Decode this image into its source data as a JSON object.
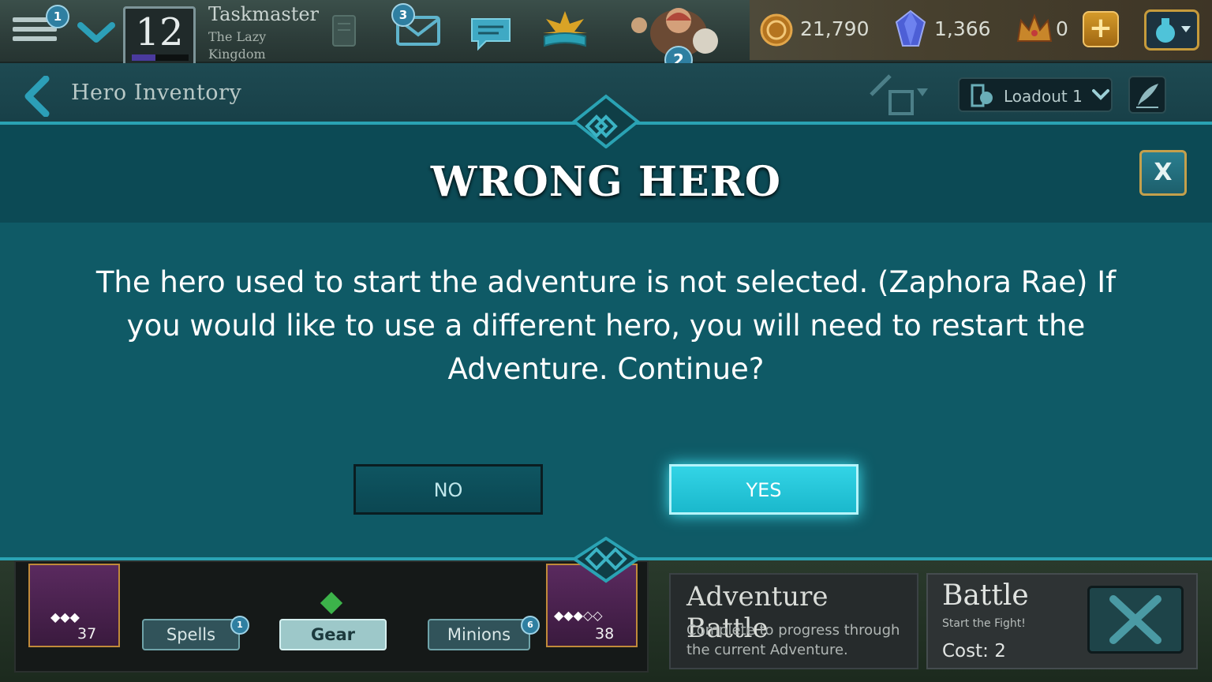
{
  "topbar": {
    "menu_badge": "1",
    "level": "12",
    "player_name": "Taskmaster",
    "player_title": "The Lazy Kingdom",
    "mail_badge": "3",
    "hero_badge": "2",
    "gold": "21,790",
    "gems": "1,366",
    "crowns": "0",
    "plus_label": "+"
  },
  "subheader": {
    "title": "Hero Inventory",
    "loadout_label": "Loadout 1"
  },
  "modal": {
    "title": "WRONG HERO",
    "message": "The hero used to start the adventure is not selected. (Zaphora Rae) If you would like to use a different hero, you will need to restart the Adventure. Continue?",
    "no_label": "NO",
    "yes_label": "YES",
    "close_label": "X"
  },
  "bottom": {
    "card_left_count": "37",
    "card_right_count": "38",
    "tabs": [
      {
        "label": "Spells",
        "badge": "1"
      },
      {
        "label": "Gear",
        "badge": ""
      },
      {
        "label": "Minions",
        "badge": "6"
      }
    ],
    "adventure_title": "Adventure Battle",
    "adventure_desc": "Complete to progress through the current Adventure.",
    "battle_title": "Battle",
    "battle_sub": "Start the Fight!",
    "battle_cost": "Cost: 2"
  },
  "colors": {
    "modal_bg": "#0f5a66",
    "accent": "#2aa3b4",
    "yes_button": "#33d4e6",
    "gold_frame": "#c4a04c"
  },
  "icons": [
    "menu-icon",
    "check-icon",
    "scroll-icon",
    "mail-icon",
    "chat-icon",
    "book-icon",
    "hero-portrait-icon",
    "gold-coin-icon",
    "gem-icon",
    "crown-icon",
    "plus-icon",
    "potion-icon",
    "back-icon",
    "sword-loadout-icon",
    "quill-icon",
    "close-icon",
    "crossed-swords-icon"
  ]
}
